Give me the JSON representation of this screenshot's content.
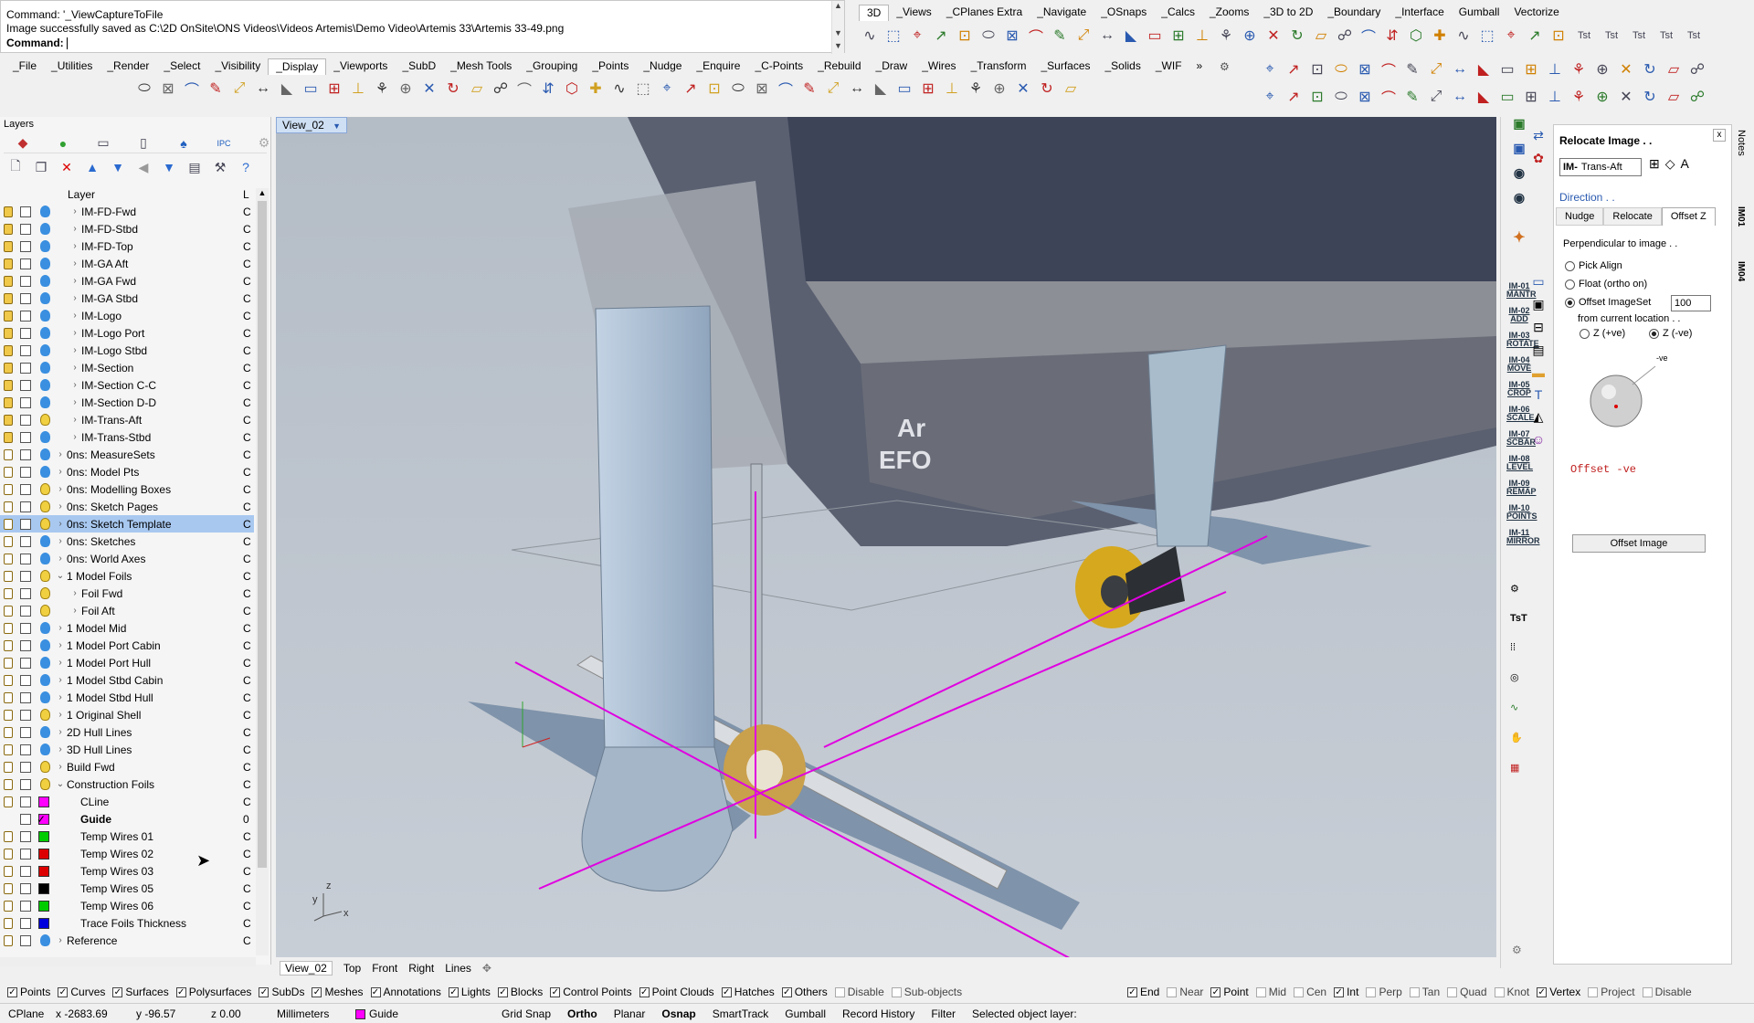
{
  "command": {
    "line1": "Command: '_ViewCaptureToFile",
    "line2": "Image successfully saved as C:\\2D OnSite\\ONS Videos\\Videos Artemis\\Demo Video\\Artemis 33\\Artemis 33-49.png",
    "prompt": "Command:"
  },
  "top_tabs": [
    "3D",
    "_Views",
    "_CPlanes Extra",
    "_Navigate",
    "_OSnaps",
    "_Calcs",
    "_Zooms",
    "_3D to 2D",
    "_Boundary",
    "_Interface",
    "Gumball",
    "Vectorize"
  ],
  "main_tabs": [
    "_File",
    "_Utilities",
    "_Render",
    "_Select",
    "_Visibility",
    "_Display",
    "_Viewports",
    "_SubD",
    "_Mesh Tools",
    "_Grouping",
    "_Points",
    "_Nudge",
    "_Enquire",
    "_C-Points",
    "_Rebuild",
    "_Draw",
    "_Wires",
    "_Transform",
    "_Surfaces",
    "_Solids",
    "_WIF"
  ],
  "tst_labels": [
    "Tst",
    "Tst",
    "Tst",
    "Tst",
    "Tst"
  ],
  "layers": {
    "title": "Layers",
    "col_layer": "Layer",
    "col_l": "L",
    "rows": [
      {
        "name": "IM-FD-Fwd",
        "lock": "c",
        "bulb": "b",
        "expand": ">",
        "indent": 2,
        "col": "C"
      },
      {
        "name": "IM-FD-Stbd",
        "lock": "c",
        "bulb": "b",
        "expand": ">",
        "indent": 2,
        "col": "C"
      },
      {
        "name": "IM-FD-Top",
        "lock": "c",
        "bulb": "b",
        "expand": ">",
        "indent": 2,
        "col": "C"
      },
      {
        "name": "IM-GA Aft",
        "lock": "c",
        "bulb": "b",
        "expand": ">",
        "indent": 2,
        "col": "C"
      },
      {
        "name": "IM-GA Fwd",
        "lock": "c",
        "bulb": "b",
        "expand": ">",
        "indent": 2,
        "col": "C"
      },
      {
        "name": "IM-GA Stbd",
        "lock": "c",
        "bulb": "b",
        "expand": ">",
        "indent": 2,
        "col": "C"
      },
      {
        "name": "IM-Logo",
        "lock": "c",
        "bulb": "b",
        "expand": ">",
        "indent": 2,
        "col": "C"
      },
      {
        "name": "IM-Logo Port",
        "lock": "c",
        "bulb": "b",
        "expand": ">",
        "indent": 2,
        "col": "C"
      },
      {
        "name": "IM-Logo Stbd",
        "lock": "c",
        "bulb": "b",
        "expand": ">",
        "indent": 2,
        "col": "C"
      },
      {
        "name": "IM-Section",
        "lock": "c",
        "bulb": "b",
        "expand": ">",
        "indent": 2,
        "col": "C"
      },
      {
        "name": "IM-Section C-C",
        "lock": "c",
        "bulb": "b",
        "expand": ">",
        "indent": 2,
        "col": "C"
      },
      {
        "name": "IM-Section D-D",
        "lock": "c",
        "bulb": "b",
        "expand": ">",
        "indent": 2,
        "col": "C"
      },
      {
        "name": "IM-Trans-Aft",
        "lock": "c",
        "bulb": "y",
        "expand": ">",
        "indent": 2,
        "col": "C"
      },
      {
        "name": "IM-Trans-Stbd",
        "lock": "c",
        "bulb": "b",
        "expand": ">",
        "indent": 2,
        "col": "C"
      },
      {
        "name": "0ns: MeasureSets",
        "lock": "o",
        "bulb": "b",
        "expand": ">",
        "indent": 1,
        "col": "C"
      },
      {
        "name": "0ns: Model Pts",
        "lock": "o",
        "bulb": "b",
        "expand": ">",
        "indent": 1,
        "col": "C"
      },
      {
        "name": "0ns: Modelling Boxes",
        "lock": "o",
        "bulb": "y",
        "expand": ">",
        "indent": 1,
        "col": "C"
      },
      {
        "name": "0ns: Sketch Pages",
        "lock": "o",
        "bulb": "y",
        "expand": ">",
        "indent": 1,
        "col": "C"
      },
      {
        "name": "0ns: Sketch Template",
        "lock": "o",
        "bulb": "y",
        "expand": ">",
        "indent": 1,
        "col": "C",
        "selected": true
      },
      {
        "name": "0ns: Sketches",
        "lock": "o",
        "bulb": "b",
        "expand": ">",
        "indent": 1,
        "col": "C"
      },
      {
        "name": "0ns: World Axes",
        "lock": "o",
        "bulb": "b",
        "expand": ">",
        "indent": 1,
        "col": "C"
      },
      {
        "name": "1 Model Foils",
        "lock": "o",
        "bulb": "y",
        "expand": "v",
        "indent": 1,
        "col": "C"
      },
      {
        "name": "Foil Fwd",
        "lock": "o",
        "bulb": "y",
        "expand": ">",
        "indent": 2,
        "col": "C"
      },
      {
        "name": "Foil Aft",
        "lock": "o",
        "bulb": "y",
        "expand": ">",
        "indent": 2,
        "col": "C"
      },
      {
        "name": "1 Model Mid",
        "lock": "o",
        "bulb": "b",
        "expand": ">",
        "indent": 1,
        "col": "C"
      },
      {
        "name": "1 Model Port Cabin",
        "lock": "o",
        "bulb": "b",
        "expand": ">",
        "indent": 1,
        "col": "C"
      },
      {
        "name": "1 Model Port Hull",
        "lock": "o",
        "bulb": "b",
        "expand": ">",
        "indent": 1,
        "col": "C"
      },
      {
        "name": "1 Model Stbd Cabin",
        "lock": "o",
        "bulb": "b",
        "expand": ">",
        "indent": 1,
        "col": "C"
      },
      {
        "name": "1 Model Stbd Hull",
        "lock": "o",
        "bulb": "b",
        "expand": ">",
        "indent": 1,
        "col": "C"
      },
      {
        "name": "1 Original Shell",
        "lock": "o",
        "bulb": "y",
        "expand": ">",
        "indent": 1,
        "col": "C"
      },
      {
        "name": "2D Hull Lines",
        "lock": "o",
        "bulb": "b",
        "expand": ">",
        "indent": 1,
        "col": "C"
      },
      {
        "name": "3D Hull Lines",
        "lock": "o",
        "bulb": "b",
        "expand": ">",
        "indent": 1,
        "col": "C"
      },
      {
        "name": "Build Fwd",
        "lock": "o",
        "bulb": "y",
        "expand": ">",
        "indent": 1,
        "col": "C"
      },
      {
        "name": "Construction Foils",
        "lock": "o",
        "bulb": "y",
        "expand": "v",
        "indent": 1,
        "col": "C"
      },
      {
        "name": "CLine",
        "lock": "o",
        "bulb": "y",
        "expand": "",
        "indent": 2,
        "col": "C",
        "swatch": "#ff00ff"
      },
      {
        "name": "Guide",
        "lock": "",
        "bulb": "",
        "expand": "",
        "indent": 2,
        "col": "0",
        "swatch": "#ff00ff",
        "current": true
      },
      {
        "name": "Temp Wires 01",
        "lock": "o",
        "bulb": "y",
        "expand": "",
        "indent": 2,
        "col": "C",
        "swatch": "#00cc00"
      },
      {
        "name": "Temp Wires 02",
        "lock": "o",
        "bulb": "y",
        "expand": "",
        "indent": 2,
        "col": "C",
        "swatch": "#dd0000"
      },
      {
        "name": "Temp Wires 03",
        "lock": "o",
        "bulb": "y",
        "expand": "",
        "indent": 2,
        "col": "C",
        "swatch": "#dd0000"
      },
      {
        "name": "Temp Wires 05",
        "lock": "o",
        "bulb": "y",
        "expand": "",
        "indent": 2,
        "col": "C",
        "swatch": "#000000"
      },
      {
        "name": "Temp Wires 06",
        "lock": "o",
        "bulb": "y",
        "expand": "",
        "indent": 2,
        "col": "C",
        "swatch": "#00cc00"
      },
      {
        "name": "Trace Foils Thickness",
        "lock": "o",
        "bulb": "y",
        "expand": "",
        "indent": 2,
        "col": "C",
        "swatch": "#0000dd"
      },
      {
        "name": "Reference",
        "lock": "o",
        "bulb": "b",
        "expand": ">",
        "indent": 1,
        "col": "C"
      }
    ]
  },
  "viewport": {
    "label": "View_02",
    "logo_text1": "Ar",
    "logo_text2": "EFO"
  },
  "strip_labels": [
    "IM-01 MANTR",
    "IM-02 ADD",
    "IM-03 ROTATE",
    "IM-04 MOVE",
    "IM-05 CROP",
    "IM-06 SCALE",
    "IM-07 SCBAR",
    "IM-08 LEVEL",
    "IM-09 REMAP",
    "IM-10 POINTS",
    "IM-11 MIRROR"
  ],
  "reloc": {
    "title": "Relocate Image . .",
    "im_label": "IM-",
    "select_value": "Trans-Aft",
    "direction": "Direction . .",
    "tabs": [
      "Nudge",
      "Relocate",
      "Offset Z"
    ],
    "perp": "Perpendicular to image . .",
    "opt1": "Pick Align",
    "opt2": "Float (ortho on)",
    "opt3": "Offset ImageSet",
    "offset_value": "100",
    "from_loc": "from current location . .",
    "zpos": "Z (+ve)",
    "zneg": "Z (-ve)",
    "ve_label": "-ve",
    "offset_caption": "Offset -ve",
    "button": "Offset Image"
  },
  "vertical_tabs": [
    "Notes",
    "IM01",
    "IM04"
  ],
  "view_tabs": [
    "View_02",
    "Top",
    "Front",
    "Right",
    "Lines"
  ],
  "filters_left": [
    {
      "label": "Points",
      "on": true
    },
    {
      "label": "Curves",
      "on": true
    },
    {
      "label": "Surfaces",
      "on": true
    },
    {
      "label": "Polysurfaces",
      "on": true
    },
    {
      "label": "SubDs",
      "on": true
    },
    {
      "label": "Meshes",
      "on": true
    },
    {
      "label": "Annotations",
      "on": true
    },
    {
      "label": "Lights",
      "on": true
    },
    {
      "label": "Blocks",
      "on": true
    },
    {
      "label": "Control Points",
      "on": true
    },
    {
      "label": "Point Clouds",
      "on": true
    },
    {
      "label": "Hatches",
      "on": true
    },
    {
      "label": "Others",
      "on": true
    },
    {
      "label": "Disable",
      "on": false
    },
    {
      "label": "Sub-objects",
      "on": false
    }
  ],
  "filters_right": [
    {
      "label": "End",
      "on": true
    },
    {
      "label": "Near",
      "on": false
    },
    {
      "label": "Point",
      "on": true
    },
    {
      "label": "Mid",
      "on": false
    },
    {
      "label": "Cen",
      "on": false
    },
    {
      "label": "Int",
      "on": true
    },
    {
      "label": "Perp",
      "on": false
    },
    {
      "label": "Tan",
      "on": false
    },
    {
      "label": "Quad",
      "on": false
    },
    {
      "label": "Knot",
      "on": false
    },
    {
      "label": "Vertex",
      "on": true
    },
    {
      "label": "Project",
      "on": false
    },
    {
      "label": "Disable",
      "on": false
    }
  ],
  "status": {
    "cplane": "CPlane",
    "x": "x -2683.69",
    "y": "y -96.57",
    "z": "z 0.00",
    "units": "Millimeters",
    "layer": "Guide",
    "layer_color": "#ff00ff",
    "toggles": [
      "Grid Snap",
      "Ortho",
      "Planar",
      "Osnap",
      "SmartTrack",
      "Gumball",
      "Record History",
      "Filter"
    ],
    "bold_toggles": [
      "Ortho",
      "Osnap"
    ],
    "message": "Selected object layer:"
  }
}
